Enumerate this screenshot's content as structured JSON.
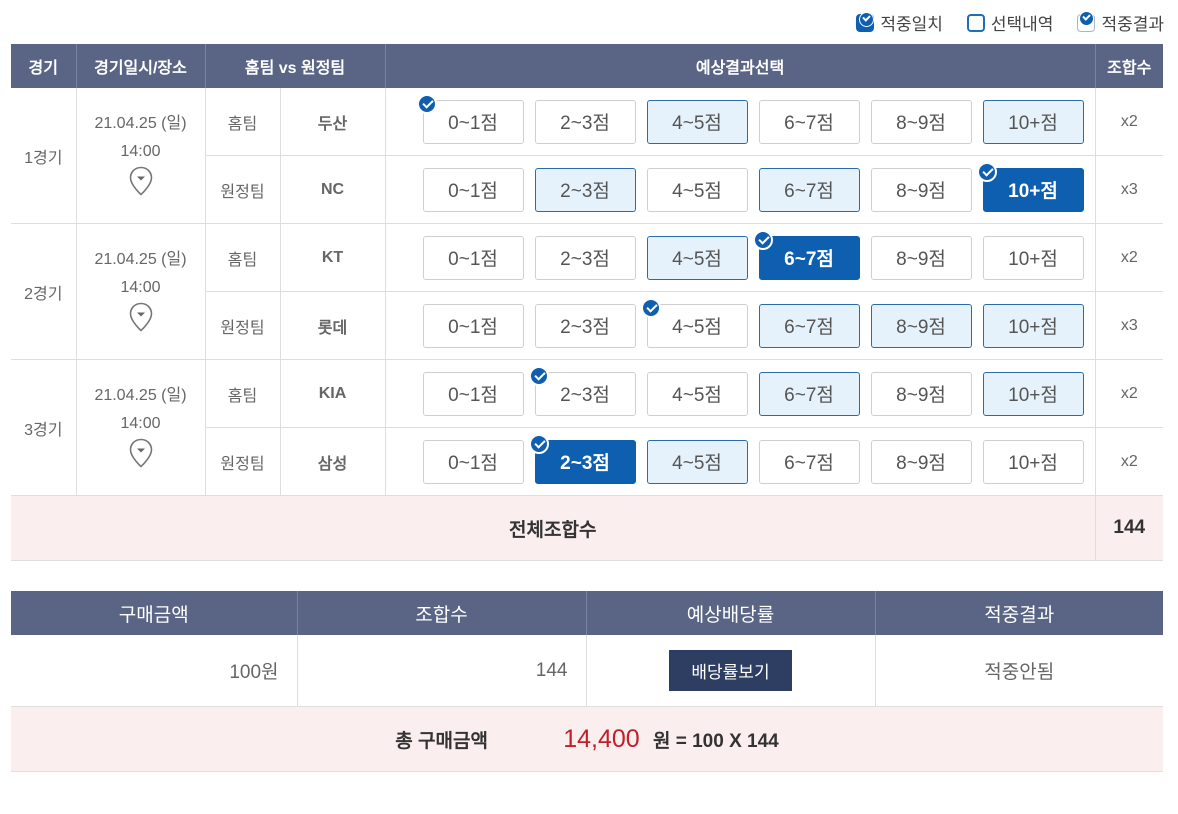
{
  "legend": {
    "match": "적중일치",
    "selected": "선택내역",
    "result": "적중결과"
  },
  "headers": {
    "game": "경기",
    "datetime": "경기일시/장소",
    "teams": "홈팀 vs 원정팀",
    "prediction": "예상결과선택",
    "combos": "조합수"
  },
  "options": [
    "0~1점",
    "2~3점",
    "4~5점",
    "6~7점",
    "8~9점",
    "10+점"
  ],
  "games": [
    {
      "no": "1경기",
      "date": "21.04.25 (일)",
      "time": "14:00",
      "rows": [
        {
          "role": "홈팀",
          "team": "두산",
          "multiplier": "x2",
          "states": [
            {
              "check": true
            },
            {},
            {
              "sel": true
            },
            {},
            {},
            {
              "sel": true
            }
          ]
        },
        {
          "role": "원정팀",
          "team": "NC",
          "multiplier": "x3",
          "states": [
            {},
            {
              "sel": true
            },
            {},
            {
              "sel": true
            },
            {},
            {
              "res": true,
              "check": true
            }
          ]
        }
      ]
    },
    {
      "no": "2경기",
      "date": "21.04.25 (일)",
      "time": "14:00",
      "rows": [
        {
          "role": "홈팀",
          "team": "KT",
          "multiplier": "x2",
          "states": [
            {},
            {},
            {
              "sel": true
            },
            {
              "res": true,
              "check": true
            },
            {},
            {}
          ]
        },
        {
          "role": "원정팀",
          "team": "롯데",
          "multiplier": "x3",
          "states": [
            {},
            {},
            {
              "check": true
            },
            {
              "sel": true
            },
            {
              "sel": true
            },
            {
              "sel": true
            }
          ]
        }
      ]
    },
    {
      "no": "3경기",
      "date": "21.04.25 (일)",
      "time": "14:00",
      "rows": [
        {
          "role": "홈팀",
          "team": "KIA",
          "multiplier": "x2",
          "states": [
            {},
            {
              "check": true
            },
            {},
            {
              "sel": true
            },
            {},
            {
              "sel": true
            }
          ]
        },
        {
          "role": "원정팀",
          "team": "삼성",
          "multiplier": "x2",
          "states": [
            {},
            {
              "res": true,
              "check": true
            },
            {
              "sel": true
            },
            {},
            {},
            {}
          ]
        }
      ]
    }
  ],
  "total": {
    "label": "전체조합수",
    "value": "144"
  },
  "summary": {
    "headers": [
      "구매금액",
      "조합수",
      "예상배당률",
      "적중결과"
    ],
    "amount": "100원",
    "combos": "144",
    "odds_button": "배당률보기",
    "result": "적중안됨"
  },
  "grand": {
    "label": "총 구매금액",
    "value": "14,400",
    "formula": "원 = 100 X 144"
  },
  "colors": {
    "header": "#5a6484",
    "accent": "#0e5fb0",
    "selected_bg": "#e6f2fb",
    "total_bg": "#fbeeee",
    "grand_value": "#c0202a"
  }
}
